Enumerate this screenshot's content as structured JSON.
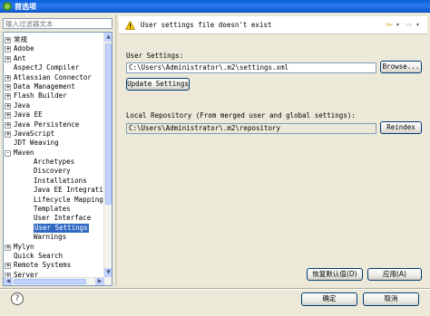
{
  "window": {
    "title": "首选项"
  },
  "filter": {
    "placeholder": "输入过滤器文本"
  },
  "tree": {
    "items": [
      {
        "label": "常规",
        "indent": 0,
        "expander": "+"
      },
      {
        "label": "Adobe",
        "indent": 0,
        "expander": "+"
      },
      {
        "label": "Ant",
        "indent": 0,
        "expander": "+"
      },
      {
        "label": "AspectJ Compiler",
        "indent": 0,
        "expander": ""
      },
      {
        "label": "Atlassian Connector",
        "indent": 0,
        "expander": "+"
      },
      {
        "label": "Data Management",
        "indent": 0,
        "expander": "+"
      },
      {
        "label": "Flash Builder",
        "indent": 0,
        "expander": "+"
      },
      {
        "label": "Java",
        "indent": 0,
        "expander": "+"
      },
      {
        "label": "Java EE",
        "indent": 0,
        "expander": "+"
      },
      {
        "label": "Java Persistence",
        "indent": 0,
        "expander": "+"
      },
      {
        "label": "JavaScript",
        "indent": 0,
        "expander": "+"
      },
      {
        "label": "JDT Weaving",
        "indent": 0,
        "expander": ""
      },
      {
        "label": "Maven",
        "indent": 0,
        "expander": "-"
      },
      {
        "label": "Archetypes",
        "indent": 1,
        "expander": ""
      },
      {
        "label": "Discovery",
        "indent": 1,
        "expander": ""
      },
      {
        "label": "Installations",
        "indent": 1,
        "expander": ""
      },
      {
        "label": "Java EE Integratio",
        "indent": 1,
        "expander": ""
      },
      {
        "label": "Lifecycle Mappings",
        "indent": 1,
        "expander": ""
      },
      {
        "label": "Templates",
        "indent": 1,
        "expander": ""
      },
      {
        "label": "User Interface",
        "indent": 1,
        "expander": ""
      },
      {
        "label": "User Settings",
        "indent": 1,
        "expander": "",
        "selected": true
      },
      {
        "label": "Warnings",
        "indent": 1,
        "expander": ""
      },
      {
        "label": "Mylyn",
        "indent": 0,
        "expander": "+"
      },
      {
        "label": "Quick Search",
        "indent": 0,
        "expander": ""
      },
      {
        "label": "Remote Systems",
        "indent": 0,
        "expander": "+"
      },
      {
        "label": "Server",
        "indent": 0,
        "expander": "+"
      }
    ]
  },
  "message": {
    "text": "User settings file doesn't exist",
    "icon": "warning-icon"
  },
  "user_settings": {
    "label": "User Settings:",
    "value": "C:\\Users\\Administrator\\.m2\\settings.xml",
    "browse_label": "Browse...",
    "update_label": "Update Settings"
  },
  "local_repo": {
    "label": "Local Repository (From merged user and global settings):",
    "value": "C:\\Users\\Administrator\\.m2\\repository",
    "reindex_label": "Reindex"
  },
  "buttons": {
    "restore_defaults": "恢复默认值(D)",
    "apply": "应用(A)",
    "ok": "确定",
    "cancel": "取消"
  },
  "help": {
    "glyph": "?"
  }
}
